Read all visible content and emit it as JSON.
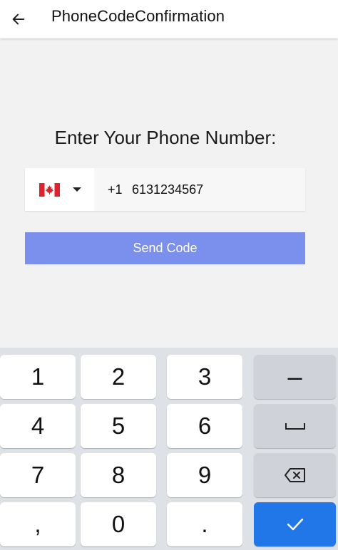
{
  "app_bar": {
    "title": "PhoneCodeConfirmation",
    "back_icon": "arrow-left-icon"
  },
  "prompt": "Enter Your Phone Number:",
  "phone": {
    "country_flag": "canada-flag-icon",
    "dial_code": "+1",
    "number": "6131234567"
  },
  "send_button": {
    "label": "Send Code",
    "color": "#7b8fed"
  },
  "keyboard": {
    "keys": {
      "k1": "1",
      "k2": "2",
      "k3": "3",
      "k4": "4",
      "k5": "5",
      "k6": "6",
      "k7": "7",
      "k8": "8",
      "k9": "9",
      "comma": ",",
      "k0": "0",
      "period": "."
    },
    "minus_label": "–",
    "enter_color": "#2176e8"
  }
}
